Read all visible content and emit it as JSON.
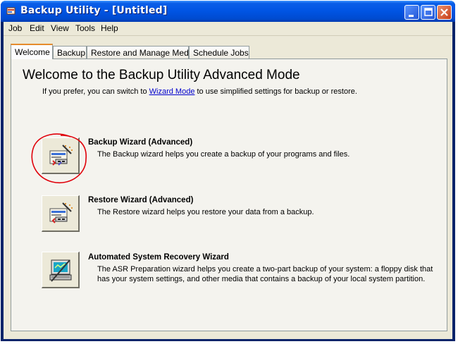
{
  "window": {
    "title": "Backup Utility - [Untitled]"
  },
  "menu": [
    "Job",
    "Edit",
    "View",
    "Tools",
    "Help"
  ],
  "tabs": [
    "Welcome",
    "Backup",
    "Restore and Manage Media",
    "Schedule Jobs"
  ],
  "welcome": {
    "heading": "Welcome to the Backup Utility Advanced Mode",
    "intro_before": "If you prefer, you can switch to ",
    "intro_link": "Wizard Mode",
    "intro_after": " to use simplified settings for backup or restore."
  },
  "wizards": [
    {
      "title": "Backup Wizard (Advanced)",
      "description": "The Backup wizard helps you create a backup of your programs and files.",
      "icon": "backup-wizard-icon"
    },
    {
      "title": "Restore Wizard (Advanced)",
      "description": "The Restore wizard helps you restore your data from a backup.",
      "icon": "restore-wizard-icon"
    },
    {
      "title": "Automated System Recovery Wizard",
      "description": "The ASR Preparation wizard helps you create a two-part backup of your system: a floppy disk that has your system settings, and other media that contains a backup of your local system partition.",
      "icon": "asr-wizard-icon"
    }
  ],
  "colors": {
    "titlebar": "#0054e3",
    "window_bg": "#ece9d8",
    "link": "#0000cc",
    "annotation": "#e0000a"
  }
}
